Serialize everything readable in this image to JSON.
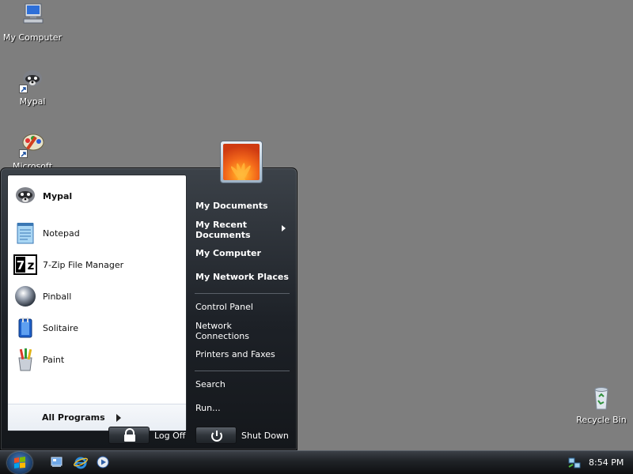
{
  "desktop": {
    "icons": [
      {
        "label": "My Computer"
      },
      {
        "label": "Mypal"
      },
      {
        "label": "Microsoft"
      },
      {
        "label": "Recycle Bin"
      }
    ]
  },
  "start_menu": {
    "pinned": [
      {
        "label": "Mypal"
      }
    ],
    "recent": [
      {
        "label": "Notepad"
      },
      {
        "label": "7-Zip File Manager"
      },
      {
        "label": "Pinball"
      },
      {
        "label": "Solitaire"
      },
      {
        "label": "Paint"
      }
    ],
    "all_programs": "All Programs",
    "right": {
      "my_documents": "My Documents",
      "my_recent_documents_line1": "My Recent",
      "my_recent_documents_line2": "Documents",
      "my_computer": "My Computer",
      "my_network_places": "My Network Places",
      "control_panel": "Control Panel",
      "network_connections_line1": "Network",
      "network_connections_line2": "Connections",
      "printers_and_faxes": "Printers and Faxes",
      "search": "Search",
      "run": "Run..."
    },
    "log_off": "Log Off",
    "shut_down": "Shut Down"
  },
  "taskbar": {
    "clock": "8:54 PM",
    "quick_launch": [
      "show-desktop-icon",
      "internet-explorer-icon",
      "media-player-icon"
    ]
  }
}
